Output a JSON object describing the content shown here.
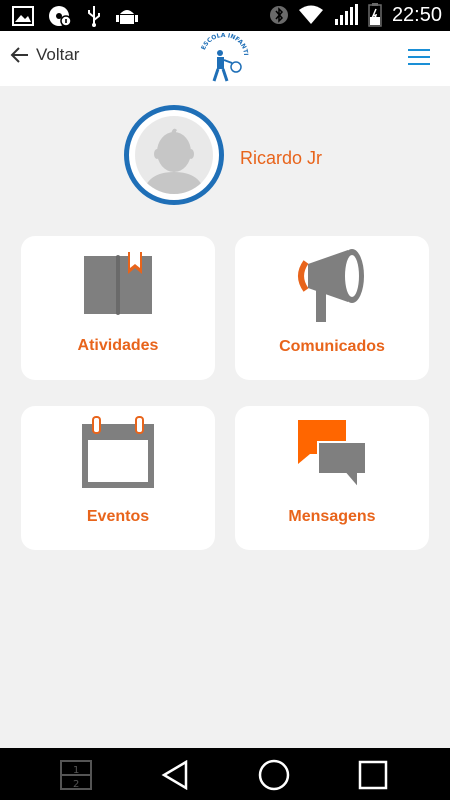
{
  "status_bar": {
    "time": "22:50",
    "icons_left": [
      "image-icon",
      "cd-info-icon",
      "usb-icon",
      "android-debug-icon"
    ],
    "icons_right": [
      "bluetooth-icon",
      "wifi-icon",
      "signal-icon",
      "battery-icon"
    ]
  },
  "app_bar": {
    "back_label": "Voltar",
    "logo_text": "ESCOLA INFANTIL",
    "menu_icon": "hamburger-icon"
  },
  "profile": {
    "name": "Ricardo Jr",
    "avatar_icon": "user-avatar-icon"
  },
  "cards": [
    {
      "label": "Atividades",
      "icon": "book-bookmark-icon"
    },
    {
      "label": "Comunicados",
      "icon": "megaphone-icon"
    },
    {
      "label": "Eventos",
      "icon": "calendar-icon"
    },
    {
      "label": "Mensagens",
      "icon": "chat-bubbles-icon"
    }
  ],
  "nav_bar": {
    "buttons": [
      "multi-window-icon",
      "back-triangle-icon",
      "home-circle-icon",
      "recents-square-icon"
    ]
  },
  "colors": {
    "accent": "#e8641b",
    "blue": "#1f6fb7",
    "menu_blue": "#1a8fd6",
    "icon_gray": "#7f7f7f"
  }
}
